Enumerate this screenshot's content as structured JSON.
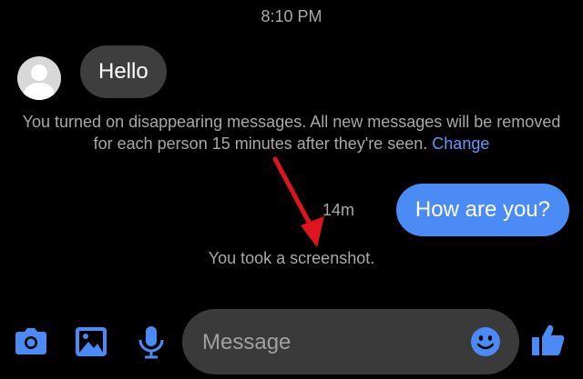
{
  "status": {
    "time": "8:10 PM"
  },
  "conversation": {
    "incoming": {
      "text": "Hello"
    },
    "system_notice": {
      "text": "You turned on disappearing messages. All new messages will be removed for each person 15 minutes after they're seen.",
      "link_label": "Change"
    },
    "outgoing": {
      "time": "14m",
      "text": "How are you?"
    },
    "screenshot_notice": "You took a screenshot."
  },
  "composer": {
    "placeholder": "Message",
    "icons": [
      "camera-icon",
      "image-icon",
      "microphone-icon",
      "emoji-icon",
      "thumbs-up-icon"
    ]
  },
  "colors": {
    "background": "#000000",
    "incoming_bubble": "#3e3e3e",
    "outgoing_bubble": "#4b8bf5",
    "accent": "#4b8bf5",
    "annotation_arrow": "#e0141e"
  }
}
